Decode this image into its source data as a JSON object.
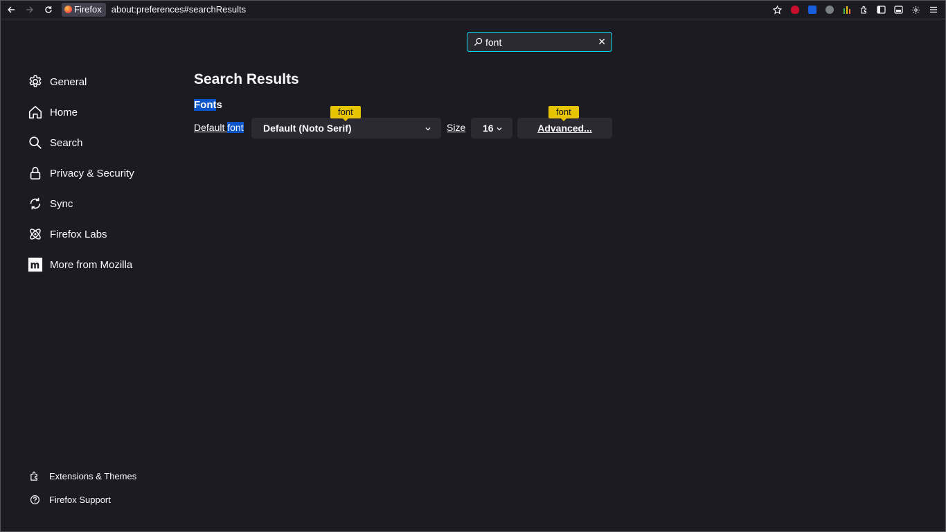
{
  "toolbar": {
    "identity_label": "Firefox",
    "url": "about:preferences#searchResults",
    "extension_colors": [
      "#c8102e",
      "#175ddc",
      "#7b7f86",
      "#3fb950"
    ]
  },
  "search": {
    "value": "font",
    "clear_icon": "close-icon"
  },
  "sidebar": {
    "items": [
      {
        "label": "General",
        "icon": "gear-icon"
      },
      {
        "label": "Home",
        "icon": "home-icon"
      },
      {
        "label": "Search",
        "icon": "search-icon"
      },
      {
        "label": "Privacy & Security",
        "icon": "lock-icon"
      },
      {
        "label": "Sync",
        "icon": "sync-icon"
      },
      {
        "label": "Firefox Labs",
        "icon": "atom-icon"
      },
      {
        "label": "More from Mozilla",
        "icon": "mozilla-icon"
      }
    ],
    "footer": [
      {
        "label": "Extensions & Themes",
        "icon": "puzzle-icon"
      },
      {
        "label": "Firefox Support",
        "icon": "help-icon"
      }
    ]
  },
  "main": {
    "title": "Search Results",
    "group_title_match": "Font",
    "group_title_rest": "s",
    "default_font_label_prefix": "Default ",
    "default_font_label_match": "font",
    "default_font_value": "Default (Noto Serif)",
    "size_label": "Size",
    "size_value": "16",
    "advanced_label": "Advanced...",
    "tooltip_text": "font",
    "highlight_color": "#0a54c9",
    "tooltip_color": "#e7c400"
  }
}
